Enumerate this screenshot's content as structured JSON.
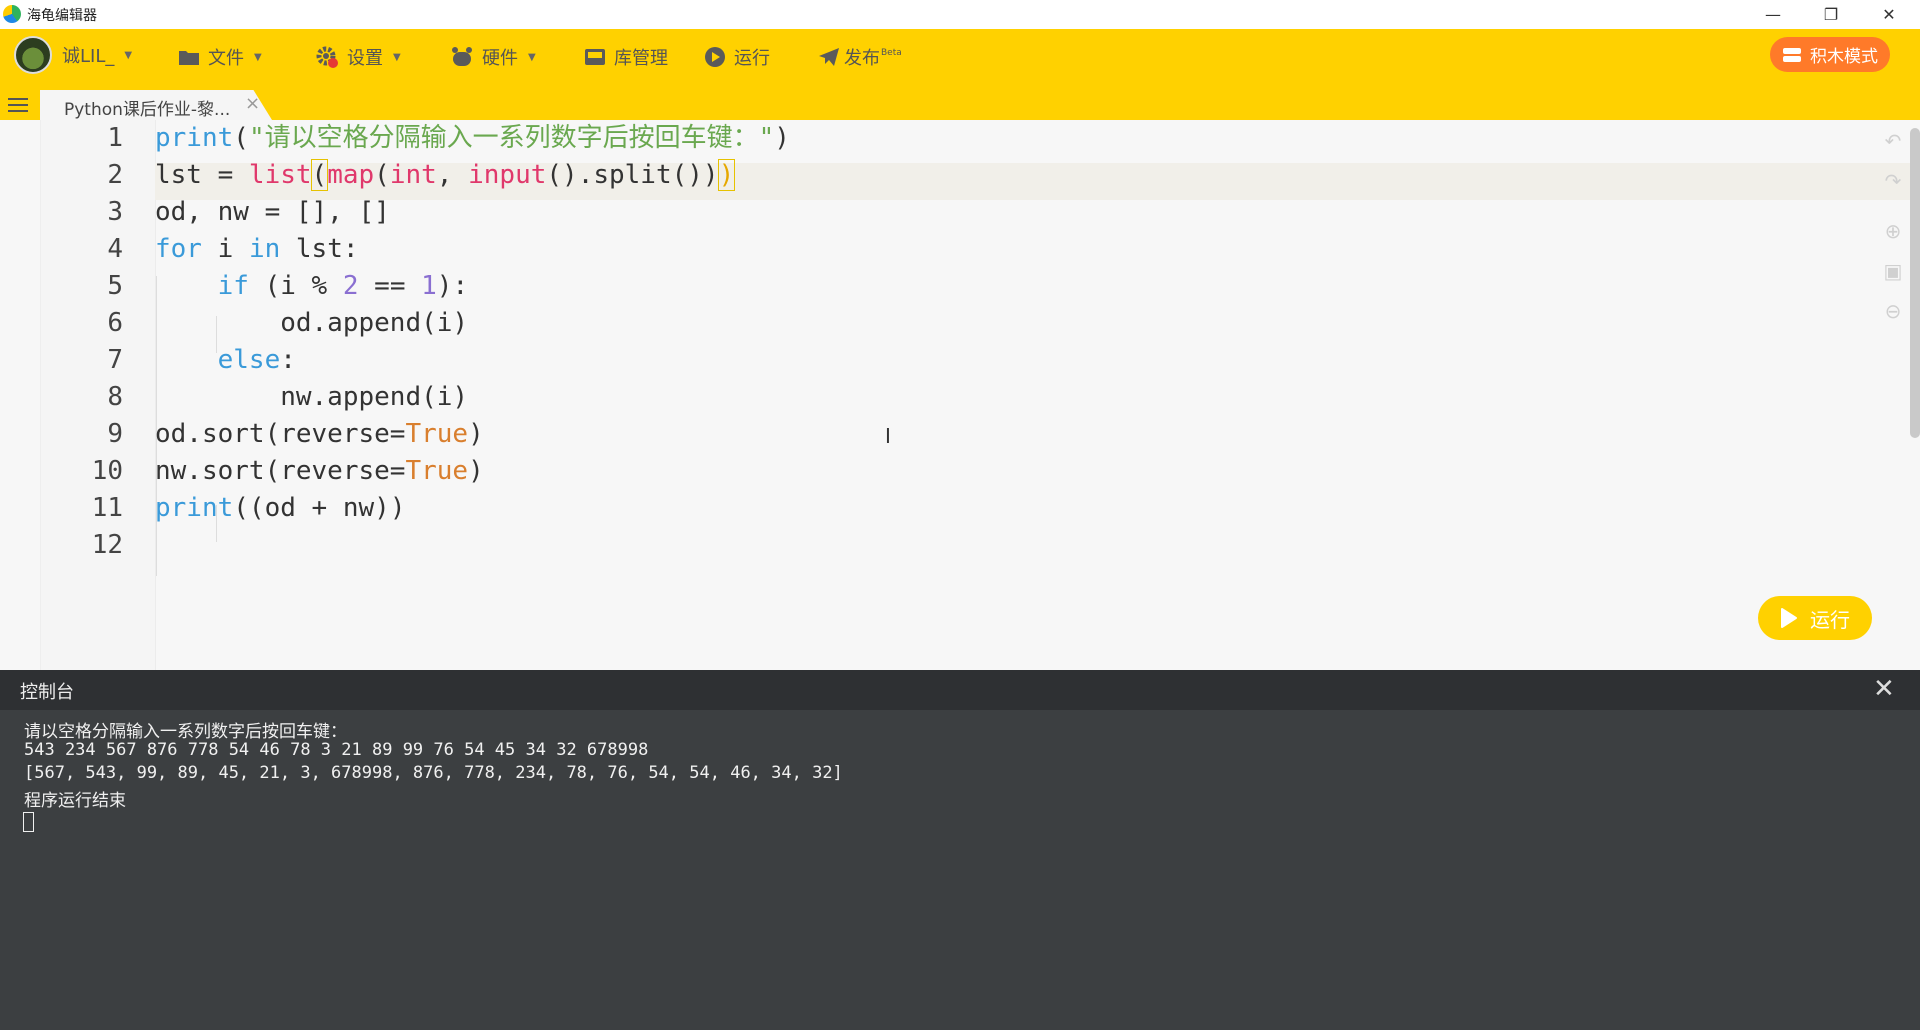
{
  "window": {
    "title": "海龟编辑器",
    "controls": [
      "—",
      "❐",
      "✕"
    ]
  },
  "toolbar": {
    "user": "诚LIL_",
    "file": "文件",
    "settings": "设置",
    "hardware": "硬件",
    "library": "库管理",
    "run": "运行",
    "publish": "发布",
    "publish_badge": "Beta",
    "block_mode": "积木模式"
  },
  "tab": {
    "label": "Python课后作业-黎...",
    "close": "×"
  },
  "editor": {
    "line_numbers": [
      "1",
      "2",
      "3",
      "4",
      "5",
      "6",
      "7",
      "8",
      "9",
      "10",
      "11",
      "12"
    ],
    "run_label": "运行"
  },
  "console": {
    "title": "控制台",
    "close": "✕",
    "lines": [
      "请以空格分隔输入一系列数字后按回车键：",
      "543 234 567 876 778 54 46 78 3 21 89 99 76 54 45 34 32 678998",
      "[567, 543, 99, 89, 45, 21, 3, 678998, 876, 778, 234, 78, 76, 54, 54, 46, 34, 32]",
      "程序运行结束"
    ]
  },
  "colors": {
    "accent": "#ffd100",
    "block_mode": "#ff7a29",
    "console_bg": "#3c3f41"
  }
}
